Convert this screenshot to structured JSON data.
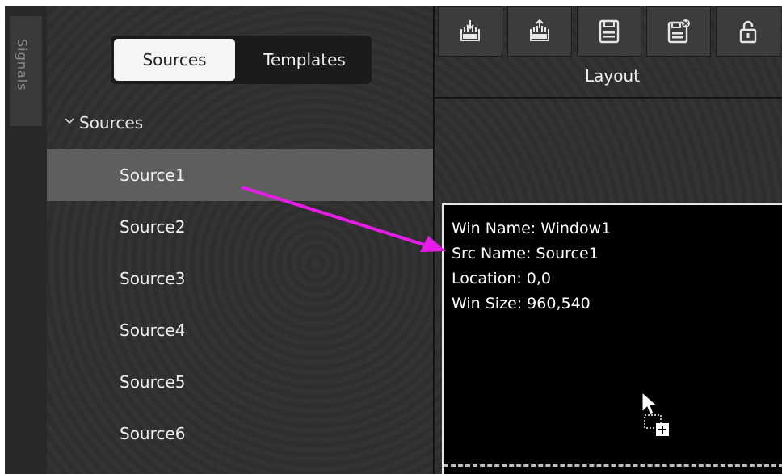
{
  "side_tab": {
    "label": "Signals"
  },
  "source_panel": {
    "tabs": [
      {
        "label": "Sources",
        "active": true
      },
      {
        "label": "Templates",
        "active": false
      }
    ],
    "tree": {
      "header_label": "Sources",
      "expand_icon": "chevron-down-icon",
      "items": [
        {
          "label": "Source1",
          "selected": true
        },
        {
          "label": "Source2",
          "selected": false
        },
        {
          "label": "Source3",
          "selected": false
        },
        {
          "label": "Source4",
          "selected": false
        },
        {
          "label": "Source5",
          "selected": false
        },
        {
          "label": "Source6",
          "selected": false
        }
      ]
    }
  },
  "toolbar": {
    "group_label": "Layout",
    "buttons": [
      {
        "icon": "import-layout-icon"
      },
      {
        "icon": "export-layout-icon"
      },
      {
        "icon": "save-icon"
      },
      {
        "icon": "save-as-close-icon"
      },
      {
        "icon": "unlock-icon"
      }
    ]
  },
  "window": {
    "lines": [
      "Win Name:  Window1",
      "Src Name:  Source1",
      "Location:  0,0",
      "Win Size:  960,540"
    ]
  },
  "annotation": {
    "color": "#e81ce8"
  },
  "colors": {
    "panel_bg": "#2f2f2f",
    "selected_row": "#5e5e5e",
    "canvas": "#000000"
  }
}
